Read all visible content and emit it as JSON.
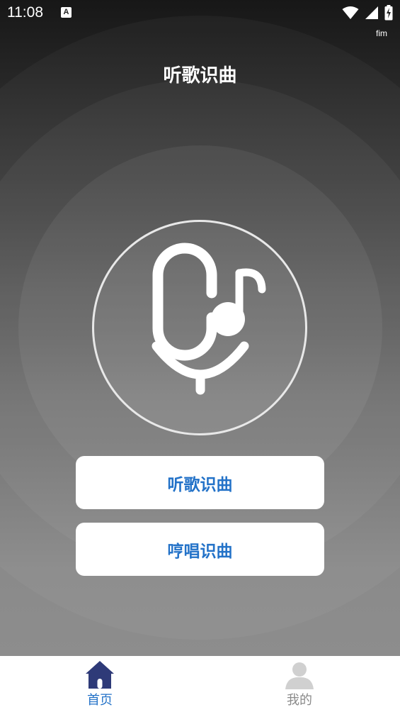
{
  "status_bar": {
    "time": "11:08",
    "notification_icon_letter": "A",
    "carrier": "fim"
  },
  "header": {
    "title": "听歌识曲"
  },
  "actions": {
    "listen_label": "听歌识曲",
    "hum_label": "哼唱识曲"
  },
  "tab_bar": {
    "home_label": "首页",
    "mine_label": "我的",
    "active_color": "#2372c8",
    "inactive_color": "#8a8a8a"
  },
  "colors": {
    "accent": "#2372c8",
    "home_icon": "#2e3a78"
  }
}
